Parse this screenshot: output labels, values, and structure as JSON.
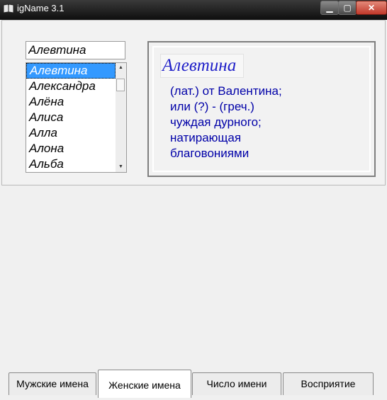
{
  "window": {
    "title": "igName 3.1"
  },
  "search": {
    "value": "Алевтина"
  },
  "names": {
    "items": [
      "Алевтина",
      "Александра",
      "Алёна",
      "Алиса",
      "Алла",
      "Алона",
      "Альба"
    ],
    "selected_index": 0
  },
  "info": {
    "name": "Алевтина",
    "description": "(лат.) от Валентина;\nили (?) - (греч.)\nчуждая дурного;\nнатирающая\nблаговониями"
  },
  "tabs": [
    {
      "label": "Мужские имена"
    },
    {
      "label": "Женские имена"
    },
    {
      "label": "Число имени"
    },
    {
      "label": "Восприятие"
    }
  ],
  "active_tab": 1,
  "colors": {
    "selection": "#3399ff",
    "name_heading": "#1e1ec8",
    "description_text": "#0000a8"
  }
}
